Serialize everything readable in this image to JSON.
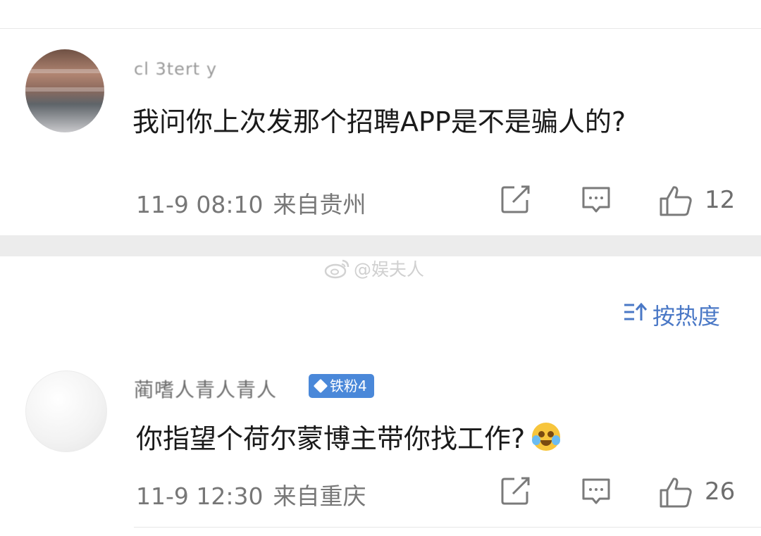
{
  "comments": [
    {
      "username": "cl 3tert   y",
      "content": "我问你上次发那个招聘APP是不是骗人的?",
      "time": "11-9 08:10",
      "location": "来自贵州",
      "likes": "12",
      "icons": [
        "avatar",
        "share-icon",
        "reply-icon",
        "like-icon"
      ]
    },
    {
      "username": "蔺嗜人青人青人",
      "fan_badge": "铁粉4",
      "content": "你指望个荷尔蒙博主带你找工作?",
      "emoji": "crying-laughing-emoji",
      "time": "11-9 12:30",
      "location": "来自重庆",
      "likes": "26",
      "icons": [
        "avatar",
        "diamond-icon",
        "share-icon",
        "reply-icon",
        "like-icon"
      ]
    }
  ],
  "watermark": {
    "text": "@娱夫人",
    "icon": "weibo-logo-icon"
  },
  "sort": {
    "label": "按热度",
    "icon": "sort-icon"
  },
  "colors": {
    "text_primary": "#1a1a1a",
    "text_secondary": "#777777",
    "accent_blue": "#4a78c6",
    "badge_blue": "#4a88d9",
    "separator_gray": "#ececec"
  }
}
